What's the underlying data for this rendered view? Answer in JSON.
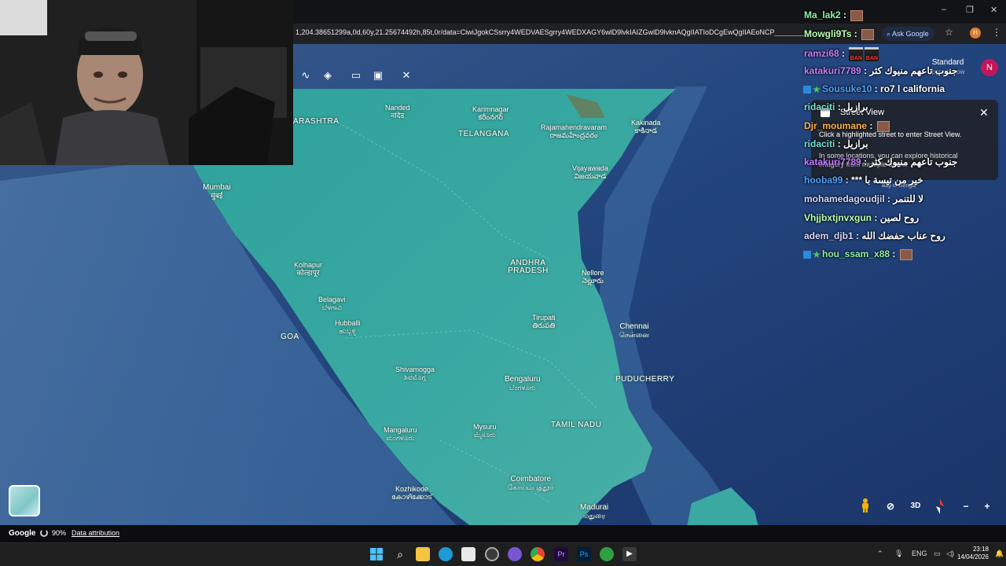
{
  "browser": {
    "url": "1,204.38651299a,0d,60y,21.25674492h,85t,0r/data=CiwiJgokCSsrry4WEDVAESgrry4WEDXAGY6wlD9lvkIAIZGwlD9lvknAQgIIATIoDCgEwQgIIAEoNCP________w",
    "ask_google": "Ask Google",
    "profile_initial": "H"
  },
  "earth": {
    "map_style": "Standard",
    "upgrade": "Upgrade now",
    "account_initial": "N",
    "mode_3d": "3D",
    "loading_pct": "90%",
    "brand": "Google",
    "data_attribution": "Data attribution"
  },
  "street_view": {
    "title": "Street View",
    "line1": "Click a highlighted street to enter Street View.",
    "line2": "In some locations, you can explore historical imagery from multiple dates."
  },
  "map": {
    "bay_label": "Bay of Bengal",
    "places": [
      {
        "id": "maharashtra",
        "name": "ARASHTRA",
        "local": ""
      },
      {
        "id": "nanded",
        "name": "Nanded",
        "local": "नांदेड"
      },
      {
        "id": "karimnagar",
        "name": "Karimnagar",
        "local": "కరీంనగర్"
      },
      {
        "id": "telangana",
        "name": "TELANGANA",
        "local": ""
      },
      {
        "id": "rajahmundry",
        "name": "Rajamahendravaram",
        "local": "రాజమహేంద్రవరం"
      },
      {
        "id": "kakinada",
        "name": "Kakinada",
        "local": "కాకినాడ"
      },
      {
        "id": "vijayawada",
        "name": "Vijayawada",
        "local": "విజయవాడ"
      },
      {
        "id": "mumbai",
        "name": "Mumbai",
        "local": "मुंबई"
      },
      {
        "id": "andhra",
        "name": "ANDHRA PRADESH",
        "local": ""
      },
      {
        "id": "nellore",
        "name": "Nellore",
        "local": "నెల్లూరు"
      },
      {
        "id": "kolhapur",
        "name": "Kolhapur",
        "local": "कोल्हापूर"
      },
      {
        "id": "belagavi",
        "name": "Belagavi",
        "local": "ಬೆಳಗಾವಿ"
      },
      {
        "id": "hubballi",
        "name": "Hubballi",
        "local": "ಹುಬ್ಬಳ್ಳಿ"
      },
      {
        "id": "goa",
        "name": "GOA",
        "local": ""
      },
      {
        "id": "tirupati",
        "name": "Tirupati",
        "local": "తిరుపతి"
      },
      {
        "id": "chennai",
        "name": "Chennai",
        "local": "சென்னை"
      },
      {
        "id": "shivamogga",
        "name": "Shivamogga",
        "local": "ಶಿವಮೊಗ್ಗ"
      },
      {
        "id": "bengaluru",
        "name": "Bengaluru",
        "local": "ಬೆಂಗಳೂರು"
      },
      {
        "id": "puducherry",
        "name": "PUDUCHERRY",
        "local": ""
      },
      {
        "id": "mangaluru",
        "name": "Mangaluru",
        "local": "ಮಂಗಳೂರು"
      },
      {
        "id": "mysuru",
        "name": "Mysuru",
        "local": "ಮೈಸೂರು"
      },
      {
        "id": "tamilnadu",
        "name": "TAMIL NADU",
        "local": ""
      },
      {
        "id": "coimbatore",
        "name": "Coimbatore",
        "local": "கோயம்புத்தூர்"
      },
      {
        "id": "kozhikode",
        "name": "Kozhikode",
        "local": "കോഴിക്കോട്"
      },
      {
        "id": "madurai",
        "name": "Madurai",
        "local": "மதுரை"
      }
    ]
  },
  "chat": [
    {
      "user": "Ma_lak2",
      "color": "#8ff0a4",
      "text": "",
      "emote": true
    },
    {
      "user": "Mowgli9Ts",
      "color": "#b8ffb0",
      "text": "",
      "emote": true
    },
    {
      "user": "ramzi68",
      "color": "#c77dff",
      "text": "",
      "ban": true
    },
    {
      "user": "katakuri7789",
      "color": "#c77dff",
      "text": "جنوب تاعهم منيوك كثر"
    },
    {
      "user": "Sousuke10",
      "color": "#4fa3ff",
      "text": "ro7 l california"
    },
    {
      "user": "ridaciti",
      "color": "#7be0d0",
      "text": "برازيل"
    },
    {
      "user": "Djr_moumane",
      "color": "#ffb347",
      "text": "",
      "emote": true
    },
    {
      "user": "ridaciti",
      "color": "#7be0d0",
      "text": "برازيل"
    },
    {
      "user": "katakuri7789",
      "color": "#c77dff",
      "text": "جنوب تاعهم منيوك كثر"
    },
    {
      "user": "hooba99",
      "color": "#4fa3ff",
      "text": "*** خير من تيسة با"
    },
    {
      "user": "mohamedagoudjil",
      "color": "#d7d7ff",
      "text": "لا للتنمر"
    },
    {
      "user": "Vhjjbxtjnvxgun",
      "color": "#b8ffb0",
      "text": "روح لصين"
    },
    {
      "user": "adem_djb1",
      "color": "#d7d7ff",
      "text": "روح عناب حفضك الله"
    },
    {
      "user": "hou_ssam_x88",
      "color": "#8ff0a4",
      "text": "",
      "emote": true
    }
  ],
  "taskbar": {
    "lang": "ENG",
    "time": "23:18",
    "date": "14/04/2026"
  },
  "colors": {
    "ocean": "#1d3a73",
    "land": "#3fa9a1",
    "accent": "#c2185b"
  }
}
